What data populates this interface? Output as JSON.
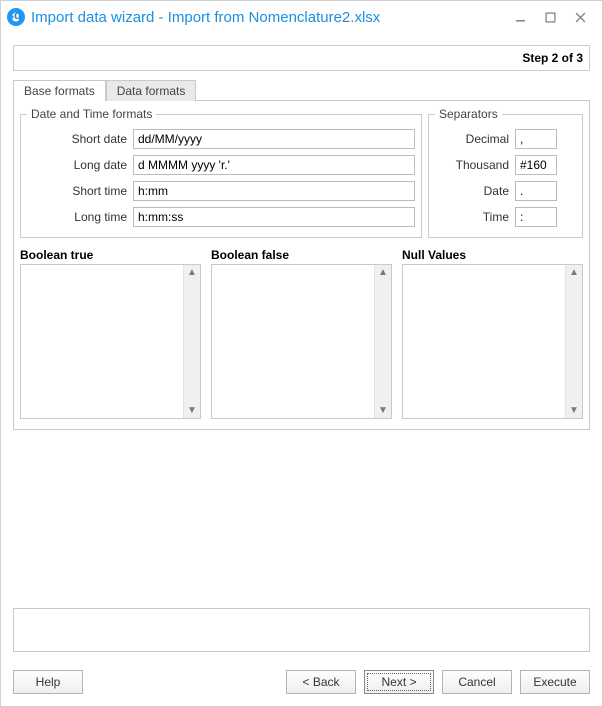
{
  "window": {
    "title": "Import data wizard - Import from Nomenclature2.xlsx"
  },
  "step": "Step 2 of 3",
  "tabs": {
    "base": "Base formats",
    "data": "Data formats"
  },
  "groups": {
    "datetime": "Date and Time formats",
    "separators": "Separators"
  },
  "datetime": {
    "short_date_label": "Short date",
    "short_date": "dd/MM/yyyy",
    "long_date_label": "Long date",
    "long_date": "d MMMM yyyy 'r.'",
    "short_time_label": "Short time",
    "short_time": "h:mm",
    "long_time_label": "Long time",
    "long_time": "h:mm:ss"
  },
  "separators": {
    "decimal_label": "Decimal",
    "decimal": ",",
    "thousand_label": "Thousand",
    "thousand": "#160",
    "date_label": "Date",
    "date": ".",
    "time_label": "Time",
    "time": ":"
  },
  "lists": {
    "bool_true": "Boolean true",
    "bool_false": "Boolean false",
    "null_vals": "Null Values"
  },
  "buttons": {
    "help": "Help",
    "back": "< Back",
    "next": "Next >",
    "cancel": "Cancel",
    "execute": "Execute"
  }
}
